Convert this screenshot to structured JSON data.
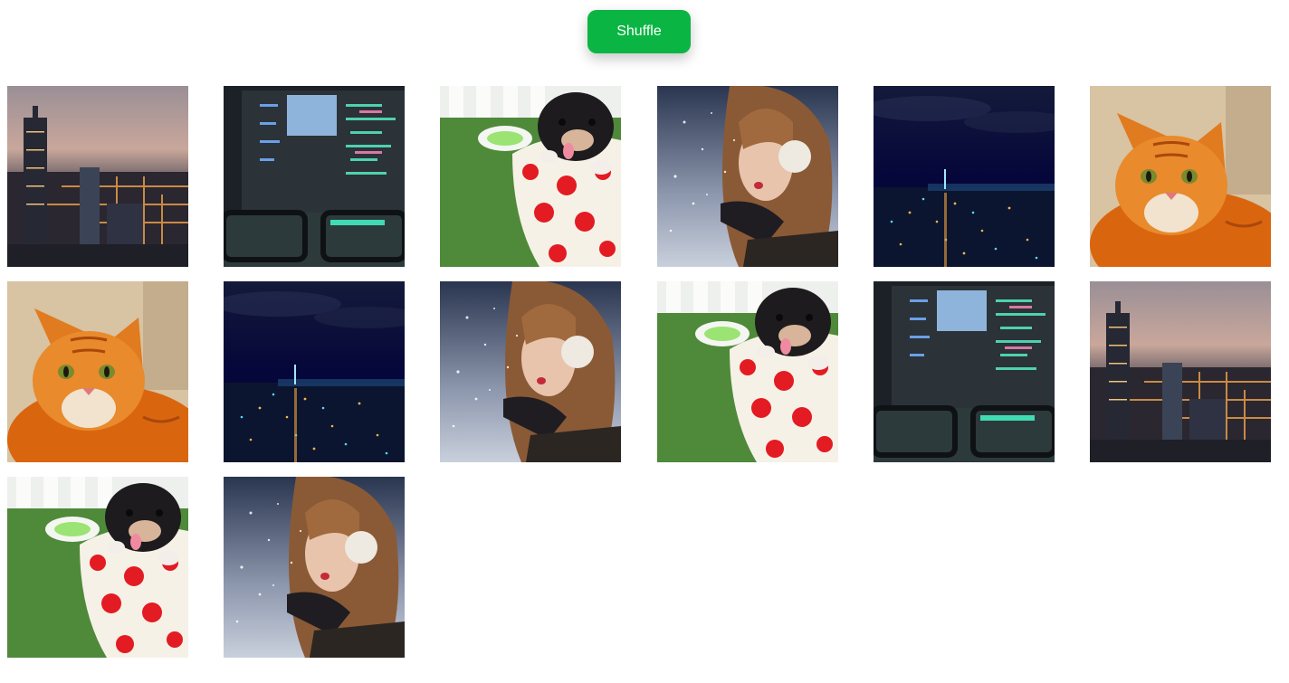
{
  "toolbar": {
    "shuffle_label": "Shuffle"
  },
  "colors": {
    "accent": "#0bb544"
  },
  "gallery": {
    "tiles": [
      {
        "image": "city-skyline-dusk"
      },
      {
        "image": "code-monitor-glasses"
      },
      {
        "image": "puppy-in-polka-dot-cup"
      },
      {
        "image": "woman-blowing-snow"
      },
      {
        "image": "city-night-aerial"
      },
      {
        "image": "orange-tabby-cat"
      },
      {
        "image": "orange-tabby-cat"
      },
      {
        "image": "city-night-aerial"
      },
      {
        "image": "woman-blowing-snow"
      },
      {
        "image": "puppy-in-polka-dot-cup"
      },
      {
        "image": "code-monitor-glasses"
      },
      {
        "image": "city-skyline-dusk"
      },
      {
        "image": "puppy-in-polka-dot-cup"
      },
      {
        "image": "woman-blowing-snow"
      }
    ]
  }
}
